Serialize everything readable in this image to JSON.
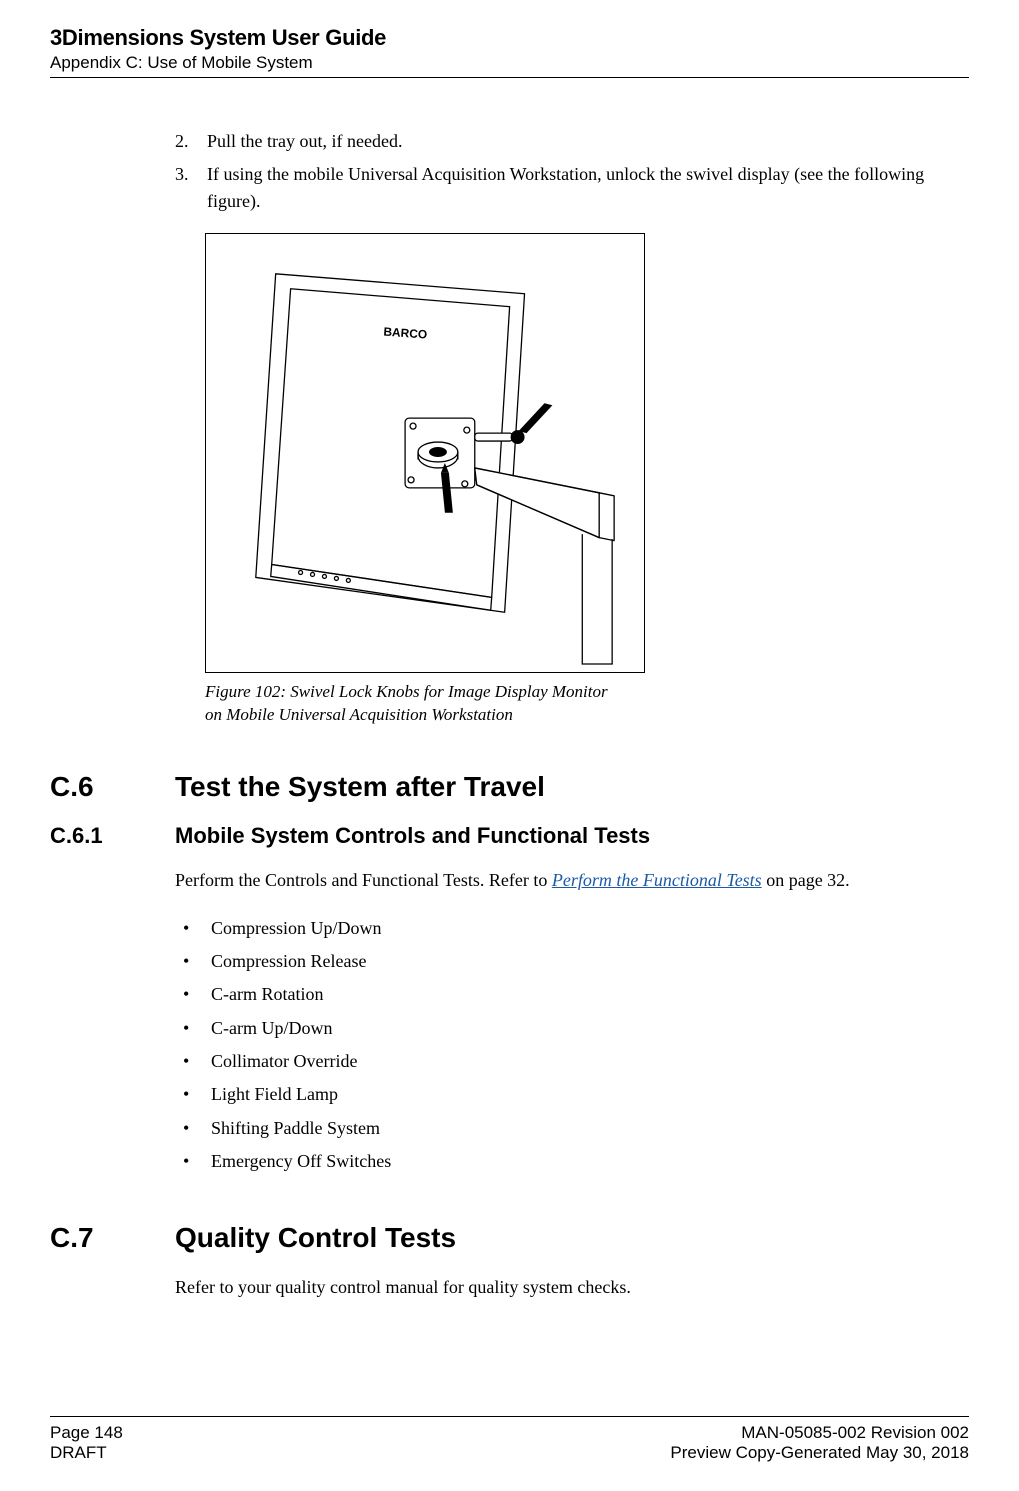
{
  "header": {
    "title": "3Dimensions System User Guide",
    "subtitle": "Appendix C: Use of Mobile System"
  },
  "steps": [
    {
      "num": "2.",
      "text": "Pull the tray out, if needed."
    },
    {
      "num": "3.",
      "text": "If using the mobile Universal Acquisition Workstation, unlock the swivel display (see the following figure)."
    }
  ],
  "figure": {
    "caption_line1": "Figure 102: Swivel Lock Knobs for Image Display Monitor",
    "caption_line2": "on Mobile Universal Acquisition Workstation",
    "monitor_brand": "BARCO"
  },
  "section_c6": {
    "num": "C.6",
    "title": "Test the System after Travel"
  },
  "section_c6_1": {
    "num": "C.6.1",
    "title": "Mobile System Controls and Functional Tests",
    "intro_pre": "Perform the Controls and Functional Tests. Refer to ",
    "intro_link": "Perform the Functional Tests",
    "intro_post": " on page 32.",
    "bullets": [
      "Compression Up/Down",
      "Compression Release",
      "C-arm Rotation",
      "C-arm Up/Down",
      "Collimator Override",
      "Light Field Lamp",
      "Shifting Paddle System",
      "Emergency Off Switches"
    ]
  },
  "section_c7": {
    "num": "C.7",
    "title": "Quality Control Tests",
    "text": "Refer to your quality control manual for quality system checks."
  },
  "footer": {
    "left1": "Page 148",
    "left2": "DRAFT",
    "right1": "MAN-05085-002 Revision 002",
    "right2": "Preview Copy-Generated May 30, 2018"
  }
}
